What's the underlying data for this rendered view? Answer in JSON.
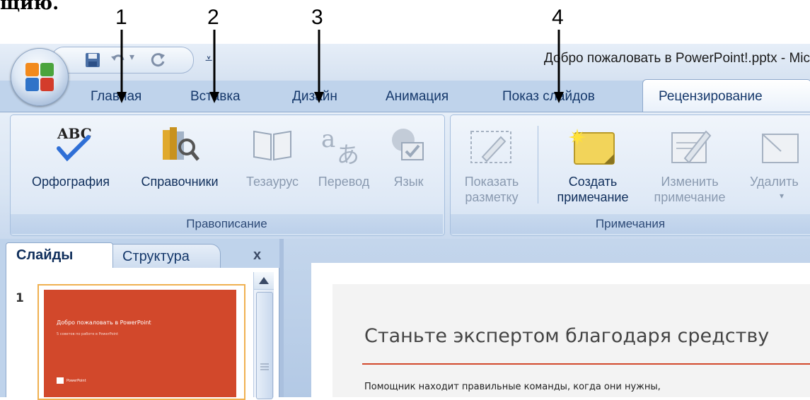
{
  "heading_fragment": "щию.",
  "annotations": [
    "1",
    "2",
    "3",
    "4"
  ],
  "window": {
    "title": "Добро пожаловать в PowerPoint!.pptx - Mic"
  },
  "quick_access": {
    "items": [
      "save-icon",
      "undo-icon",
      "undo-dropdown-icon",
      "redo-icon",
      "customize-icon"
    ]
  },
  "tabs": [
    {
      "label": "Главная"
    },
    {
      "label": "Вставка"
    },
    {
      "label": "Дизайн"
    },
    {
      "label": "Анимация"
    },
    {
      "label": "Показ слайдов"
    },
    {
      "label": "Рецензирование",
      "active": true
    }
  ],
  "ribbon": {
    "groups": [
      {
        "label": "Правописание",
        "buttons": [
          {
            "label": "Орфография",
            "icon": "spelling-abc-icon",
            "enabled": true
          },
          {
            "label": "Справочники",
            "icon": "research-books-icon",
            "enabled": true
          },
          {
            "label": "Тезаурус",
            "icon": "thesaurus-book-icon",
            "enabled": false
          },
          {
            "label": "Перевод",
            "icon": "translate-icon",
            "enabled": false
          },
          {
            "label": "Язык",
            "icon": "language-globe-icon",
            "enabled": false
          }
        ]
      },
      {
        "label": "Примечания",
        "buttons": [
          {
            "label": "Показать",
            "label2": "разметку",
            "icon": "show-markup-icon",
            "enabled": false
          },
          {
            "label": "Создать",
            "label2": "примечание",
            "icon": "new-comment-icon",
            "enabled": true
          },
          {
            "label": "Изменить",
            "label2": "примечание",
            "icon": "edit-comment-icon",
            "enabled": false
          },
          {
            "label": "Удалить",
            "icon": "delete-comment-icon",
            "enabled": false
          }
        ]
      }
    ]
  },
  "slides_pane": {
    "tabs": [
      "Слайды",
      "Структура"
    ],
    "close": "x",
    "thumbnail": {
      "number": "1",
      "title": "Добро пожаловать в PowerPoint",
      "subtitle": "5 советов по работе в PowerPoint",
      "brand": "PowerPoint"
    }
  },
  "slide": {
    "title": "Станьте экспертом благодаря средству",
    "body": "Помощник находит правильные команды, когда они нужны,"
  },
  "colors": {
    "ribbon_bg": "#dfe9f6",
    "tab_row": "#bfd3eb",
    "accent_orange": "#d2482b"
  }
}
